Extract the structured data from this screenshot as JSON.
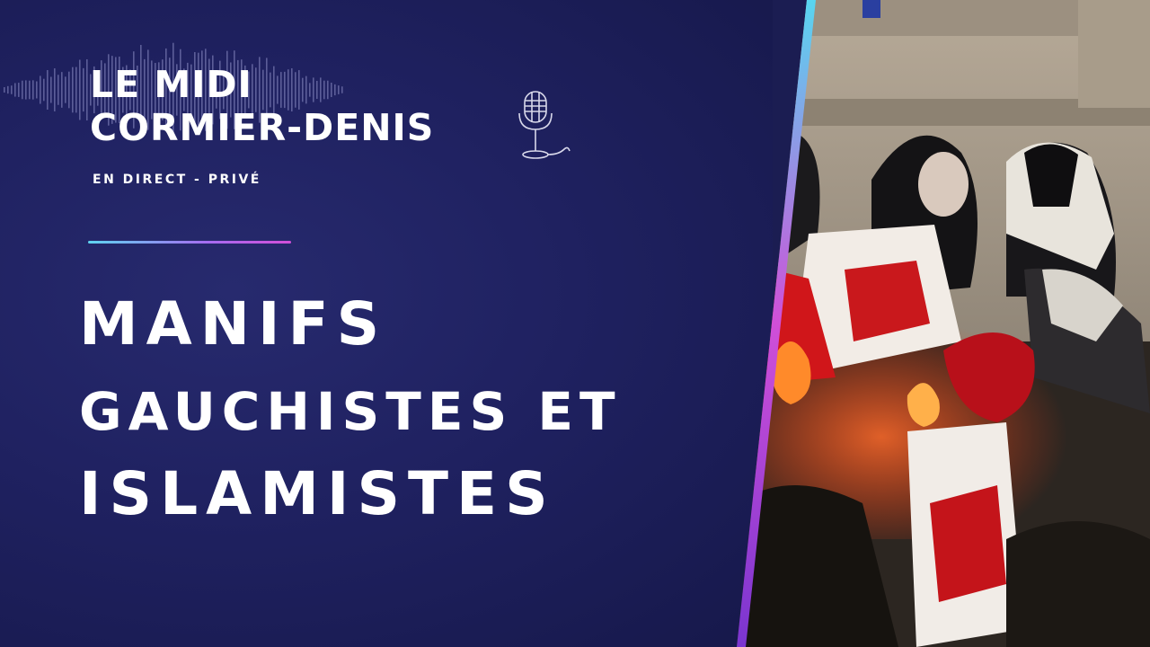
{
  "show": {
    "title_line1": "LE MIDI",
    "title_line2": "CORMIER-DENIS",
    "subtitle": "EN DIRECT - PRIVÉ"
  },
  "headline": {
    "line1": "MANIFS",
    "line2": "GAUCHISTES ET",
    "line3": "ISLAMISTES"
  },
  "icons": [
    "microphone-icon",
    "audio-waveform"
  ],
  "colors": {
    "background": "#1f2160",
    "accent_cyan": "#5fd4f0",
    "accent_magenta": "#d24fd8",
    "accent_purple": "#8a3fd8",
    "text": "#ffffff"
  }
}
